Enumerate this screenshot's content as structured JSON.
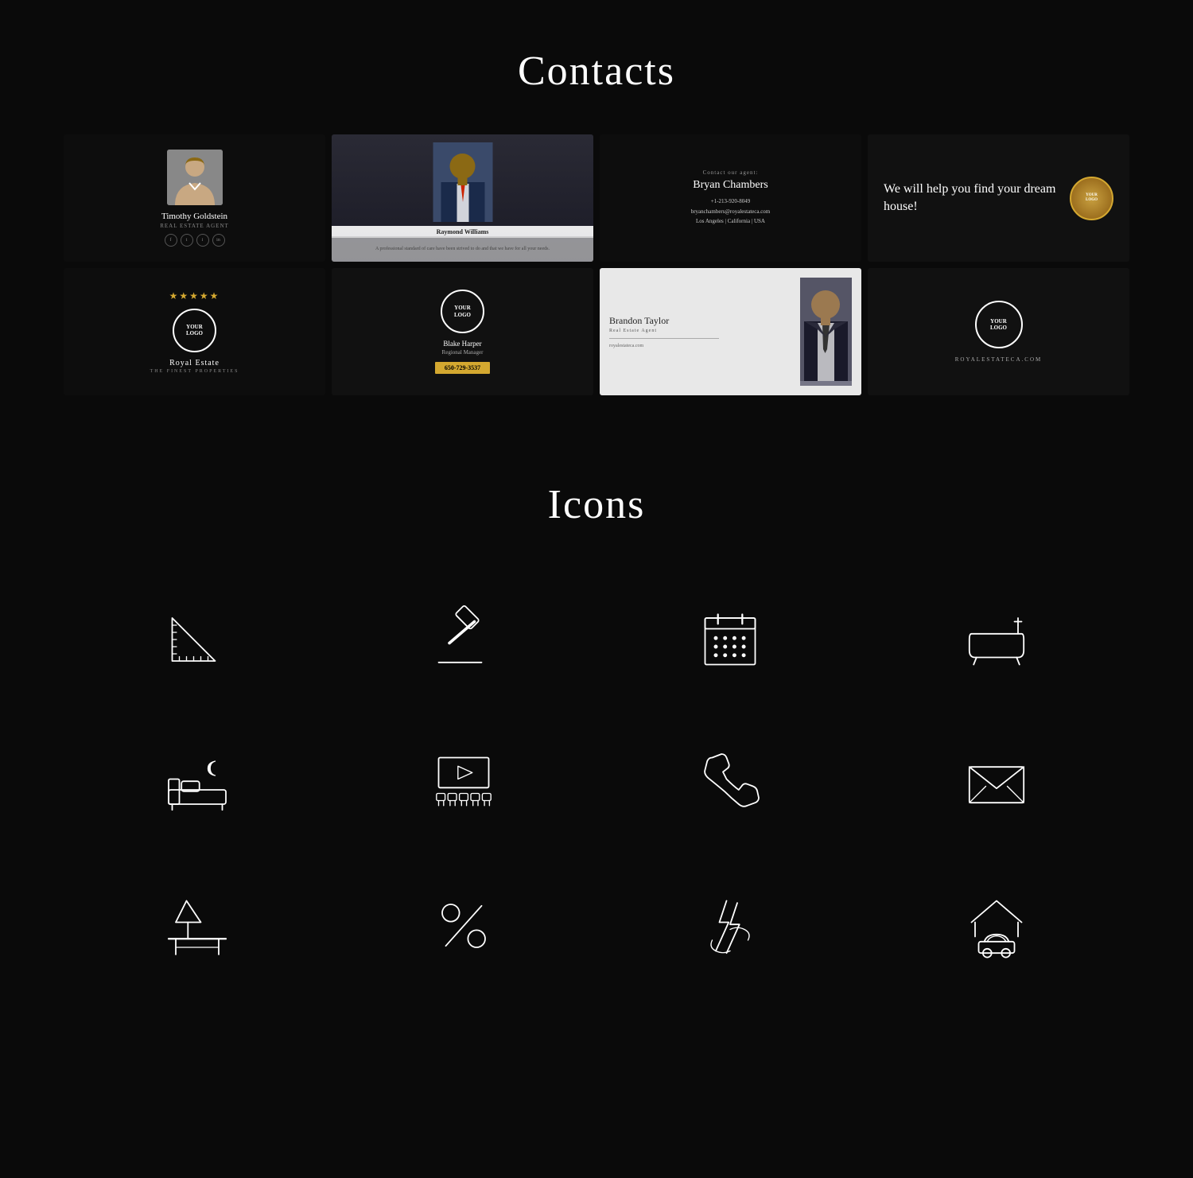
{
  "sections": {
    "contacts": {
      "title": "Contacts"
    },
    "icons": {
      "title": "Icons"
    }
  },
  "cards": [
    {
      "id": "card-timothy",
      "agent_name": "Timothy Goldstein",
      "agent_title": "REAL ESTATE AGENT"
    },
    {
      "id": "card-raymond",
      "agent_name": "Raymond Williams",
      "agent_desc": "A professional standard of care have been strived to do and that we have for all your needs."
    },
    {
      "id": "card-bryan",
      "label": "Contact our agent:",
      "agent_name": "Bryan Chambers",
      "phone": "+1-213-920-8049",
      "email": "bryanchambers@royalestateca.com",
      "location": "Los Angeles | California | USA"
    },
    {
      "id": "card-dream",
      "text": "We will help you find your dream house!",
      "logo_line1": "YOUR",
      "logo_line2": "LOGO"
    },
    {
      "id": "card-royal",
      "estate_name": "Royal Estate",
      "tagline": "THE FINEST PROPERTIES",
      "logo_line1": "YOUR",
      "logo_line2": "LOGO"
    },
    {
      "id": "card-blake",
      "agent_name": "Blake Harper",
      "agent_role": "Regional Manager",
      "phone": "650-729-3537",
      "logo_line1": "YOUR",
      "logo_line2": "LOGO"
    },
    {
      "id": "card-brandon",
      "agent_name": "Brandon Taylor",
      "agent_role": "Real Estate Agent",
      "website": "royalestateca.com"
    },
    {
      "id": "card-royal2",
      "logo_line1": "YOUR",
      "logo_line2": "LOGO",
      "website": "ROYALESTATECA.COM"
    }
  ],
  "icons": [
    {
      "id": "ruler-triangle",
      "label": "Ruler Triangle"
    },
    {
      "id": "gavel",
      "label": "Gavel / Auction"
    },
    {
      "id": "calendar",
      "label": "Calendar"
    },
    {
      "id": "bathtub",
      "label": "Bathtub"
    },
    {
      "id": "bedroom",
      "label": "Bedroom / Sleep"
    },
    {
      "id": "cinema",
      "label": "Cinema / Theater"
    },
    {
      "id": "phone",
      "label": "Phone"
    },
    {
      "id": "mail",
      "label": "Mail / Envelope"
    },
    {
      "id": "lamp-table",
      "label": "Lamp and Table"
    },
    {
      "id": "percent",
      "label": "Percent"
    },
    {
      "id": "lightning",
      "label": "Lightning / Energy"
    },
    {
      "id": "garage",
      "label": "House / Garage / Car"
    }
  ]
}
